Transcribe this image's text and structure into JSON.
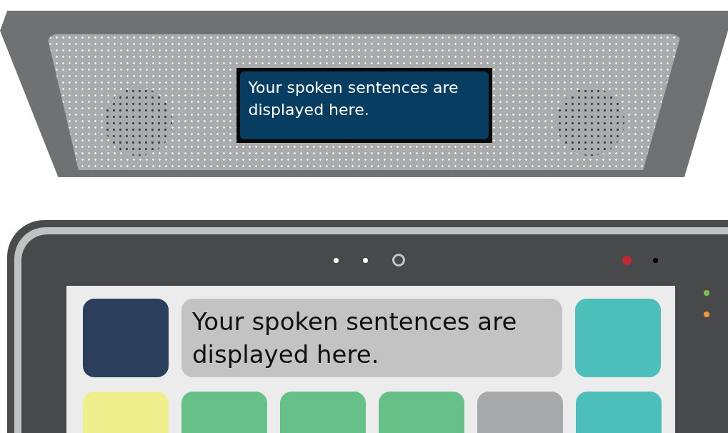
{
  "display": {
    "text": "Your spoken sentences are displayed here."
  },
  "tablet": {
    "message": "Your spoken sentences are displayed here.",
    "tiles": [
      {
        "color": "#2b3e5c"
      },
      {
        "color": "#4dbfbb"
      },
      {
        "color": "#f0ef8d"
      },
      {
        "color": "#67c088"
      },
      {
        "color": "#67c088"
      },
      {
        "color": "#67c088"
      },
      {
        "color": "#a7a9aa"
      },
      {
        "color": "#4dbfbb"
      }
    ]
  }
}
